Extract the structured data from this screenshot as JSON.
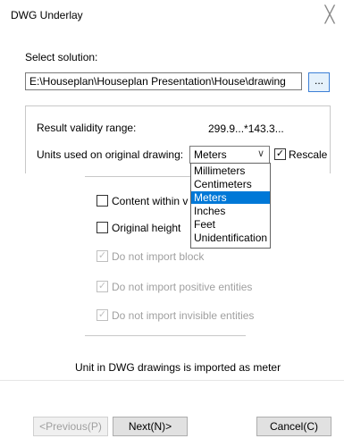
{
  "window": {
    "title": "DWG Underlay",
    "close_symbol": "╳"
  },
  "solution": {
    "label": "Select solution:",
    "path": "E:\\Houseplan\\Houseplan Presentation\\House\\drawing",
    "browse_label": "..."
  },
  "validity": {
    "label": "Result validity range:",
    "value": "299.9...*143.3..."
  },
  "units": {
    "label": "Units used on original drawing:",
    "selected": "Meters",
    "options": [
      "Millimeters",
      "Centimeters",
      "Meters",
      "Inches",
      "Feet",
      "Unidentification"
    ],
    "rescale_label": "Rescale",
    "rescale_checked": true
  },
  "options": {
    "content_within_label": "Content within v",
    "original_height_label": "Original height",
    "no_block_label": "Do not import block",
    "no_positive_label": "Do not import positive entities",
    "no_invisible_label": "Do not import invisible entities"
  },
  "info": {
    "message": "Unit in DWG drawings is imported as meter"
  },
  "buttons": {
    "previous_label": "<Previous(P)",
    "next_label": "Next(N)>",
    "cancel_label": "Cancel(C)"
  },
  "colors": {
    "selection": "#0078d7",
    "accent_border": "#3c7fd6"
  }
}
